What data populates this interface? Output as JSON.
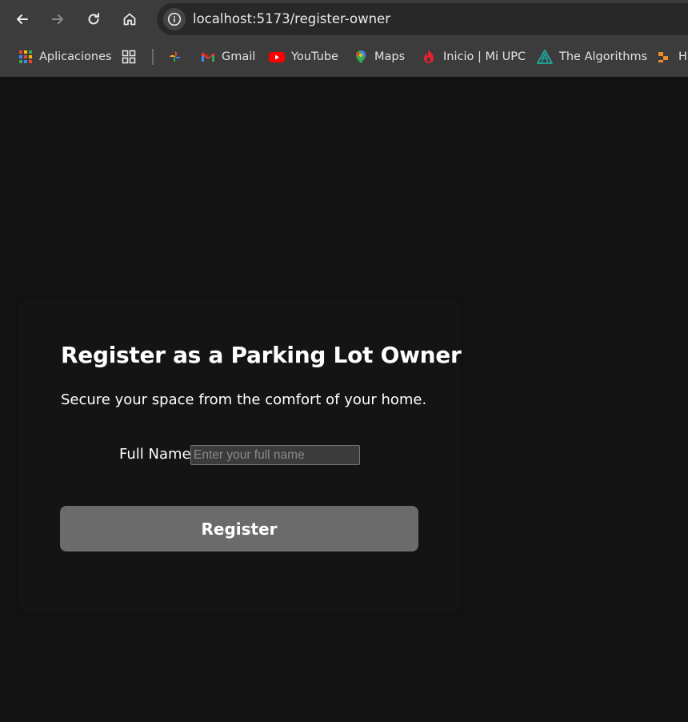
{
  "browser": {
    "url": "localhost:5173/register-owner",
    "bookmarks": [
      {
        "label": "Aplicaciones",
        "icon": "apps-grid-icon"
      },
      {
        "label": "",
        "icon": "tab-groups-icon"
      },
      {
        "label": "",
        "icon": "photos-pinwheel-icon"
      },
      {
        "label": "Gmail",
        "icon": "gmail-icon"
      },
      {
        "label": "YouTube",
        "icon": "youtube-icon"
      },
      {
        "label": "Maps",
        "icon": "maps-pin-icon"
      },
      {
        "label": "Inicio | Mi UPC",
        "icon": "upc-icon"
      },
      {
        "label": "The Algorithms",
        "icon": "algorithms-icon"
      },
      {
        "label": "H",
        "icon": "bookmark-orange-icon"
      }
    ]
  },
  "page": {
    "title": "Register as a Parking Lot Owner",
    "subtitle": "Secure your space from the comfort of your home.",
    "form": {
      "full_name_label": "Full Name",
      "full_name_placeholder": "Enter your full name",
      "full_name_value": "",
      "submit_label": "Register"
    }
  },
  "colors": {
    "page_bg": "#131313",
    "chrome_bg": "#3c3c3c",
    "button_bg": "#6b6b6b",
    "youtube_red": "#ff0000",
    "gmail_red": "#ea4335"
  }
}
